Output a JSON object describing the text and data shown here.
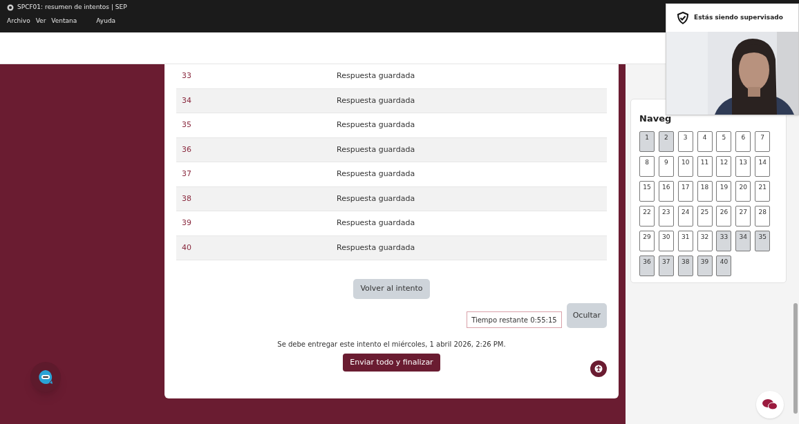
{
  "window": {
    "title": "SPCF01: resumen de intentos | SEP"
  },
  "menu": [
    "Archivo",
    "Ver",
    "Ventana",
    "Ayuda"
  ],
  "summary_rows": [
    {
      "number": "33",
      "status": "Respuesta guardada"
    },
    {
      "number": "34",
      "status": "Respuesta guardada"
    },
    {
      "number": "35",
      "status": "Respuesta guardada"
    },
    {
      "number": "36",
      "status": "Respuesta guardada"
    },
    {
      "number": "37",
      "status": "Respuesta guardada"
    },
    {
      "number": "38",
      "status": "Respuesta guardada"
    },
    {
      "number": "39",
      "status": "Respuesta guardada"
    },
    {
      "number": "40",
      "status": "Respuesta guardada"
    }
  ],
  "return_button": "Volver al intento",
  "timer": {
    "text": "Tiempo restante 0:55:15",
    "hide_button": "Ocultar"
  },
  "due_text": "Se debe entregar este intento el miércoles, 1 abril 2026, 2:26 PM.",
  "submit_button": "Enviar todo y finalizar",
  "navigation": {
    "title": "Naveg",
    "buttons": [
      {
        "label": "1",
        "answered": true
      },
      {
        "label": "2",
        "answered": true
      },
      {
        "label": "3",
        "answered": false
      },
      {
        "label": "4",
        "answered": false
      },
      {
        "label": "5",
        "answered": false
      },
      {
        "label": "6",
        "answered": false
      },
      {
        "label": "7",
        "answered": false
      },
      {
        "label": "8",
        "answered": false
      },
      {
        "label": "9",
        "answered": false
      },
      {
        "label": "10",
        "answered": false
      },
      {
        "label": "11",
        "answered": false
      },
      {
        "label": "12",
        "answered": false
      },
      {
        "label": "13",
        "answered": false
      },
      {
        "label": "14",
        "answered": false
      },
      {
        "label": "15",
        "answered": false
      },
      {
        "label": "16",
        "answered": false
      },
      {
        "label": "17",
        "answered": false
      },
      {
        "label": "18",
        "answered": false
      },
      {
        "label": "19",
        "answered": false
      },
      {
        "label": "20",
        "answered": false
      },
      {
        "label": "21",
        "answered": false
      },
      {
        "label": "22",
        "answered": false
      },
      {
        "label": "23",
        "answered": false
      },
      {
        "label": "24",
        "answered": false
      },
      {
        "label": "25",
        "answered": false
      },
      {
        "label": "26",
        "answered": false
      },
      {
        "label": "27",
        "answered": false
      },
      {
        "label": "28",
        "answered": false
      },
      {
        "label": "29",
        "answered": false
      },
      {
        "label": "30",
        "answered": false
      },
      {
        "label": "31",
        "answered": false
      },
      {
        "label": "32",
        "answered": false
      },
      {
        "label": "33",
        "answered": true
      },
      {
        "label": "34",
        "answered": true
      },
      {
        "label": "35",
        "answered": true
      },
      {
        "label": "36",
        "answered": true
      },
      {
        "label": "37",
        "answered": true
      },
      {
        "label": "38",
        "answered": true
      },
      {
        "label": "39",
        "answered": true
      },
      {
        "label": "40",
        "answered": true
      }
    ]
  },
  "proctoring": {
    "label": "Estás siendo supervisado"
  }
}
